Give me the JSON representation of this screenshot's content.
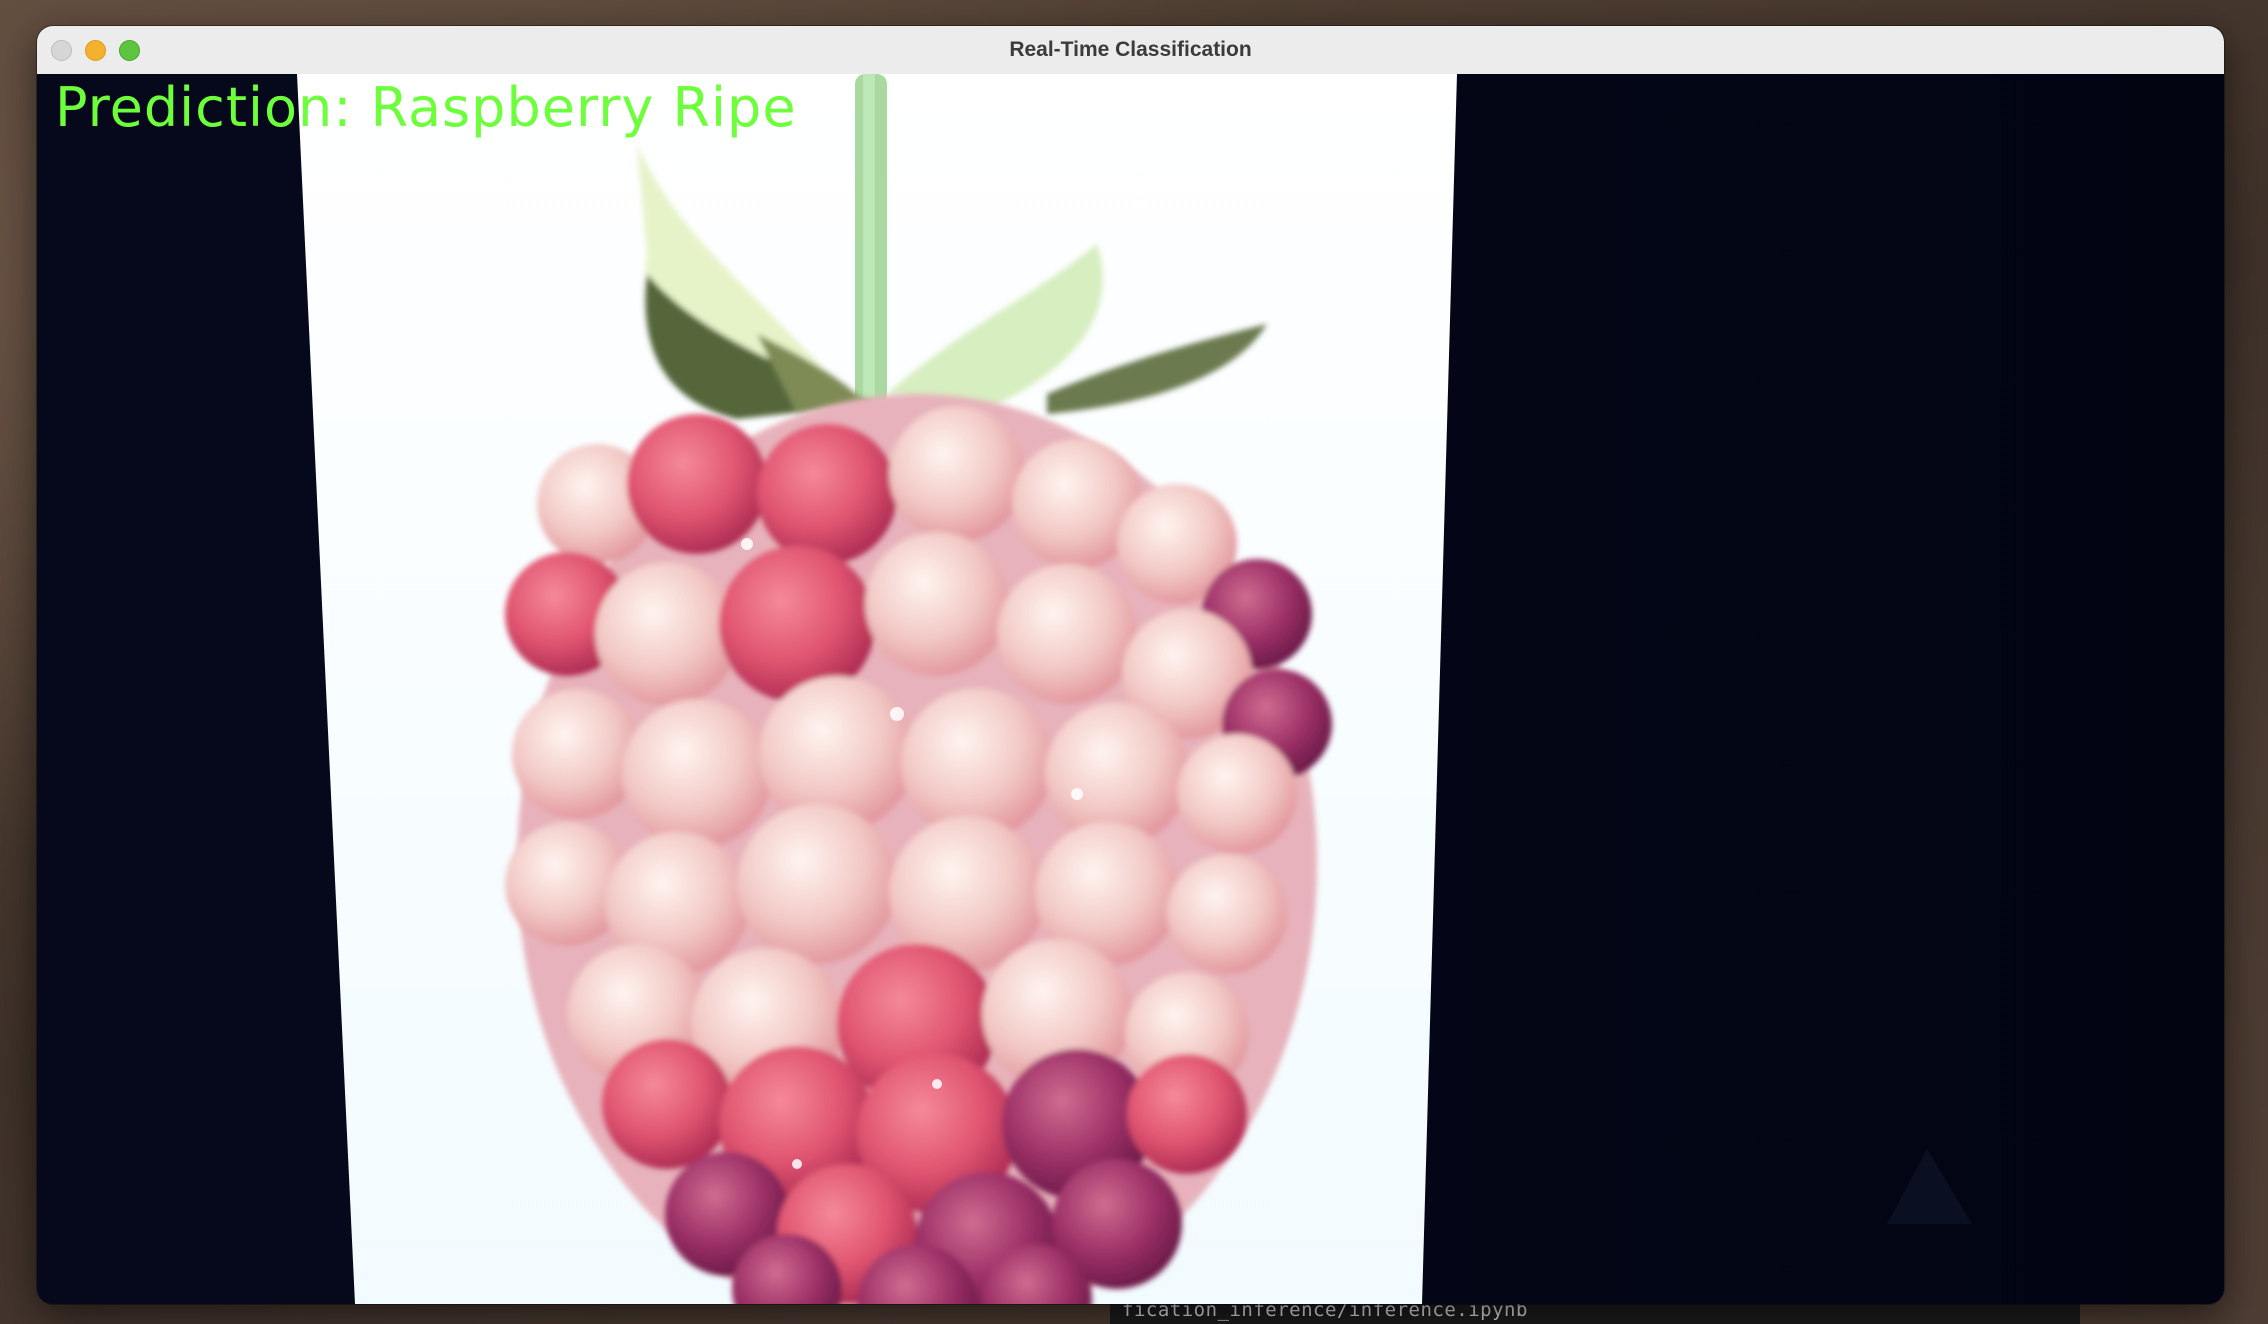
{
  "window": {
    "title": "Real-Time Classification",
    "buttons": {
      "close": "close-button",
      "minimize": "minimize-button",
      "zoom": "zoom-button"
    }
  },
  "overlay": {
    "prediction_text": "Prediction: Raspberry Ripe",
    "color": "#6dff3c"
  },
  "background_terminal": {
    "text": "fication_inference/inference.ipynb"
  },
  "colors": {
    "traffic_close": "#d6d6d6",
    "traffic_minimize": "#f3b12d",
    "traffic_zoom": "#5cc43e",
    "prediction_green": "#6dff3c"
  }
}
